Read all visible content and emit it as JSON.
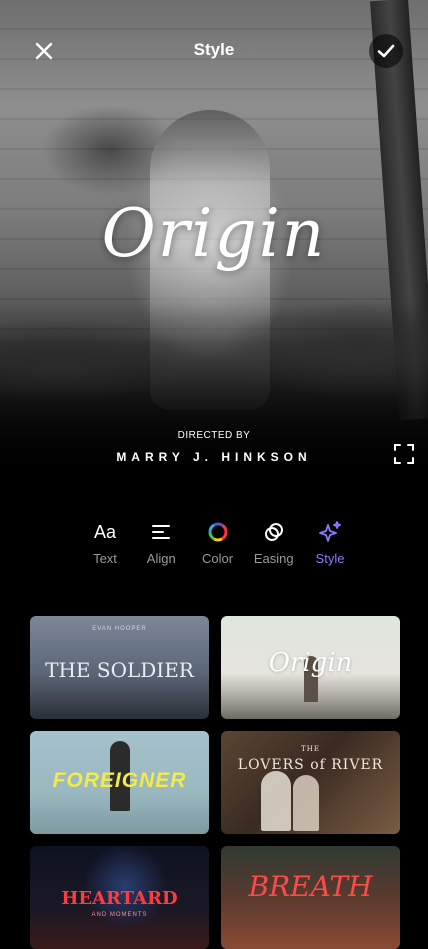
{
  "header": {
    "title": "Style"
  },
  "preview": {
    "title": "Origin",
    "directed_by": "DIRECTED BY",
    "director": "MARRY J. HINKSON"
  },
  "toolbar": {
    "items": [
      {
        "label": "Text",
        "icon": "text-aa-icon",
        "active": false
      },
      {
        "label": "Align",
        "icon": "align-left-icon",
        "active": false
      },
      {
        "label": "Color",
        "icon": "color-wheel-icon",
        "active": false
      },
      {
        "label": "Easing",
        "icon": "easing-rings-icon",
        "active": false
      },
      {
        "label": "Style",
        "icon": "sparkle-icon",
        "active": true
      }
    ],
    "glyph_text": "Aa"
  },
  "styles": [
    {
      "title": "THE SOLDIER",
      "subtitle": "EVAN HOOPER"
    },
    {
      "title": "Origin"
    },
    {
      "title": "FOREIGNER"
    },
    {
      "title": "LOVERS of RIVER",
      "subtitle": "THE"
    },
    {
      "title": "HEARTARD",
      "subtitle": "AND MOMENTS"
    },
    {
      "title": "BREATH"
    }
  ],
  "colors": {
    "accent": "#8b7bff",
    "inactive_label": "#9a9a9a",
    "background": "#000000"
  }
}
